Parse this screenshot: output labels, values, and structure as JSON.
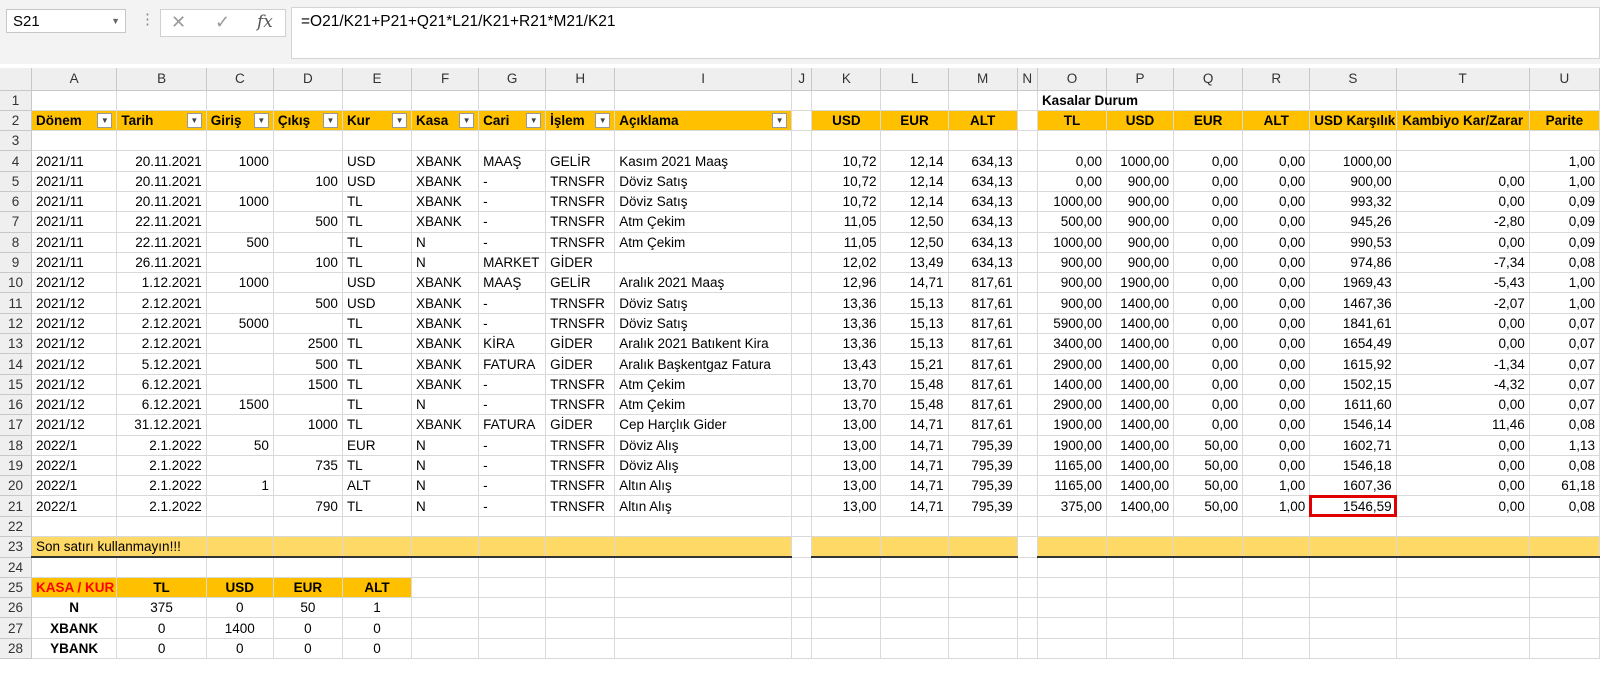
{
  "formula_bar": {
    "name_box": "S21",
    "formula": "=O21/K21+P21+Q21*L21/K21+R21*M21/K21"
  },
  "columns": [
    "",
    "A",
    "B",
    "C",
    "D",
    "E",
    "F",
    "G",
    "H",
    "I",
    "J",
    "K",
    "L",
    "M",
    "N",
    "O",
    "P",
    "Q",
    "R",
    "S",
    "T",
    "U"
  ],
  "rows": [
    {
      "n": "1",
      "cells": {
        "O": "Kasalar Durum"
      }
    },
    {
      "n": "2",
      "cells": {
        "A": "Dönem",
        "B": "Tarih",
        "C": "Giriş",
        "D": "Çıkış",
        "E": "Kur",
        "F": "Kasa",
        "G": "Cari",
        "H": "İşlem",
        "I": "Açıklama",
        "K": "USD",
        "L": "EUR",
        "M": "ALT",
        "O": "TL",
        "P": "USD",
        "Q": "EUR",
        "R": "ALT",
        "S": "USD Karşılık",
        "T": "Kambiyo Kar/Zarar",
        "U": "Parite"
      }
    },
    {
      "n": "3",
      "cells": {}
    },
    {
      "n": "4",
      "cells": {
        "A": "2021/11",
        "B": "20.11.2021",
        "C": "1000",
        "D": "",
        "E": "USD",
        "F": "XBANK",
        "G": "MAAŞ",
        "H": "GELİR",
        "I": "Kasım 2021 Maaş",
        "K": "10,72",
        "L": "12,14",
        "M": "634,13",
        "O": "0,00",
        "P": "1000,00",
        "Q": "0,00",
        "R": "0,00",
        "S": "1000,00",
        "T": "",
        "U": "1,00"
      }
    },
    {
      "n": "5",
      "cells": {
        "A": "2021/11",
        "B": "20.11.2021",
        "C": "",
        "D": "100",
        "E": "USD",
        "F": "XBANK",
        "G": "-",
        "H": "TRNSFR",
        "I": "Döviz Satış",
        "K": "10,72",
        "L": "12,14",
        "M": "634,13",
        "O": "0,00",
        "P": "900,00",
        "Q": "0,00",
        "R": "0,00",
        "S": "900,00",
        "T": "0,00",
        "U": "1,00"
      }
    },
    {
      "n": "6",
      "cells": {
        "A": "2021/11",
        "B": "20.11.2021",
        "C": "1000",
        "D": "",
        "E": "TL",
        "F": "XBANK",
        "G": "-",
        "H": "TRNSFR",
        "I": "Döviz Satış",
        "K": "10,72",
        "L": "12,14",
        "M": "634,13",
        "O": "1000,00",
        "P": "900,00",
        "Q": "0,00",
        "R": "0,00",
        "S": "993,32",
        "T": "0,00",
        "U": "0,09"
      }
    },
    {
      "n": "7",
      "cells": {
        "A": "2021/11",
        "B": "22.11.2021",
        "C": "",
        "D": "500",
        "E": "TL",
        "F": "XBANK",
        "G": "-",
        "H": "TRNSFR",
        "I": "Atm Çekim",
        "K": "11,05",
        "L": "12,50",
        "M": "634,13",
        "O": "500,00",
        "P": "900,00",
        "Q": "0,00",
        "R": "0,00",
        "S": "945,26",
        "T": "-2,80",
        "U": "0,09"
      }
    },
    {
      "n": "8",
      "cells": {
        "A": "2021/11",
        "B": "22.11.2021",
        "C": "500",
        "D": "",
        "E": "TL",
        "F": "N",
        "G": "-",
        "H": "TRNSFR",
        "I": "Atm Çekim",
        "K": "11,05",
        "L": "12,50",
        "M": "634,13",
        "O": "1000,00",
        "P": "900,00",
        "Q": "0,00",
        "R": "0,00",
        "S": "990,53",
        "T": "0,00",
        "U": "0,09"
      }
    },
    {
      "n": "9",
      "cells": {
        "A": "2021/11",
        "B": "26.11.2021",
        "C": "",
        "D": "100",
        "E": "TL",
        "F": "N",
        "G": "MARKET",
        "H": "GİDER",
        "I": "",
        "K": "12,02",
        "L": "13,49",
        "M": "634,13",
        "O": "900,00",
        "P": "900,00",
        "Q": "0,00",
        "R": "0,00",
        "S": "974,86",
        "T": "-7,34",
        "U": "0,08"
      }
    },
    {
      "n": "10",
      "cells": {
        "A": "2021/12",
        "B": "1.12.2021",
        "C": "1000",
        "D": "",
        "E": "USD",
        "F": "XBANK",
        "G": "MAAŞ",
        "H": "GELİR",
        "I": "Aralık 2021 Maaş",
        "K": "12,96",
        "L": "14,71",
        "M": "817,61",
        "O": "900,00",
        "P": "1900,00",
        "Q": "0,00",
        "R": "0,00",
        "S": "1969,43",
        "T": "-5,43",
        "U": "1,00"
      }
    },
    {
      "n": "11",
      "cells": {
        "A": "2021/12",
        "B": "2.12.2021",
        "C": "",
        "D": "500",
        "E": "USD",
        "F": "XBANK",
        "G": "-",
        "H": "TRNSFR",
        "I": "Döviz Satış",
        "K": "13,36",
        "L": "15,13",
        "M": "817,61",
        "O": "900,00",
        "P": "1400,00",
        "Q": "0,00",
        "R": "0,00",
        "S": "1467,36",
        "T": "-2,07",
        "U": "1,00"
      }
    },
    {
      "n": "12",
      "cells": {
        "A": "2021/12",
        "B": "2.12.2021",
        "C": "5000",
        "D": "",
        "E": "TL",
        "F": "XBANK",
        "G": "-",
        "H": "TRNSFR",
        "I": "Döviz Satış",
        "K": "13,36",
        "L": "15,13",
        "M": "817,61",
        "O": "5900,00",
        "P": "1400,00",
        "Q": "0,00",
        "R": "0,00",
        "S": "1841,61",
        "T": "0,00",
        "U": "0,07"
      }
    },
    {
      "n": "13",
      "cells": {
        "A": "2021/12",
        "B": "2.12.2021",
        "C": "",
        "D": "2500",
        "E": "TL",
        "F": "XBANK",
        "G": "KİRA",
        "H": "GİDER",
        "I": "Aralık 2021 Batıkent Kira",
        "K": "13,36",
        "L": "15,13",
        "M": "817,61",
        "O": "3400,00",
        "P": "1400,00",
        "Q": "0,00",
        "R": "0,00",
        "S": "1654,49",
        "T": "0,00",
        "U": "0,07"
      }
    },
    {
      "n": "14",
      "cells": {
        "A": "2021/12",
        "B": "5.12.2021",
        "C": "",
        "D": "500",
        "E": "TL",
        "F": "XBANK",
        "G": "FATURA",
        "H": "GİDER",
        "I": "Aralık Başkentgaz Fatura",
        "K": "13,43",
        "L": "15,21",
        "M": "817,61",
        "O": "2900,00",
        "P": "1400,00",
        "Q": "0,00",
        "R": "0,00",
        "S": "1615,92",
        "T": "-1,34",
        "U": "0,07"
      }
    },
    {
      "n": "15",
      "cells": {
        "A": "2021/12",
        "B": "6.12.2021",
        "C": "",
        "D": "1500",
        "E": "TL",
        "F": "XBANK",
        "G": "-",
        "H": "TRNSFR",
        "I": "Atm Çekim",
        "K": "13,70",
        "L": "15,48",
        "M": "817,61",
        "O": "1400,00",
        "P": "1400,00",
        "Q": "0,00",
        "R": "0,00",
        "S": "1502,15",
        "T": "-4,32",
        "U": "0,07"
      }
    },
    {
      "n": "16",
      "cells": {
        "A": "2021/12",
        "B": "6.12.2021",
        "C": "1500",
        "D": "",
        "E": "TL",
        "F": "N",
        "G": "-",
        "H": "TRNSFR",
        "I": "Atm Çekim",
        "K": "13,70",
        "L": "15,48",
        "M": "817,61",
        "O": "2900,00",
        "P": "1400,00",
        "Q": "0,00",
        "R": "0,00",
        "S": "1611,60",
        "T": "0,00",
        "U": "0,07"
      }
    },
    {
      "n": "17",
      "cells": {
        "A": "2021/12",
        "B": "31.12.2021",
        "C": "",
        "D": "1000",
        "E": "TL",
        "F": "XBANK",
        "G": "FATURA",
        "H": "GİDER",
        "I": "Cep Harçlık Gider",
        "K": "13,00",
        "L": "14,71",
        "M": "817,61",
        "O": "1900,00",
        "P": "1400,00",
        "Q": "0,00",
        "R": "0,00",
        "S": "1546,14",
        "T": "11,46",
        "U": "0,08"
      }
    },
    {
      "n": "18",
      "cells": {
        "A": "2022/1",
        "B": "2.1.2022",
        "C": "50",
        "D": "",
        "E": "EUR",
        "F": "N",
        "G": "-",
        "H": "TRNSFR",
        "I": "Döviz Alış",
        "K": "13,00",
        "L": "14,71",
        "M": "795,39",
        "O": "1900,00",
        "P": "1400,00",
        "Q": "50,00",
        "R": "0,00",
        "S": "1602,71",
        "T": "0,00",
        "U": "1,13"
      }
    },
    {
      "n": "19",
      "cells": {
        "A": "2022/1",
        "B": "2.1.2022",
        "C": "",
        "D": "735",
        "E": "TL",
        "F": "N",
        "G": "-",
        "H": "TRNSFR",
        "I": "Döviz Alış",
        "K": "13,00",
        "L": "14,71",
        "M": "795,39",
        "O": "1165,00",
        "P": "1400,00",
        "Q": "50,00",
        "R": "0,00",
        "S": "1546,18",
        "T": "0,00",
        "U": "0,08"
      }
    },
    {
      "n": "20",
      "cells": {
        "A": "2022/1",
        "B": "2.1.2022",
        "C": "1",
        "D": "",
        "E": "ALT",
        "F": "N",
        "G": "-",
        "H": "TRNSFR",
        "I": "Altın Alış",
        "K": "13,00",
        "L": "14,71",
        "M": "795,39",
        "O": "1165,00",
        "P": "1400,00",
        "Q": "50,00",
        "R": "1,00",
        "S": "1607,36",
        "T": "0,00",
        "U": "61,18"
      }
    },
    {
      "n": "21",
      "cells": {
        "A": "2022/1",
        "B": "2.1.2022",
        "C": "",
        "D": "790",
        "E": "TL",
        "F": "N",
        "G": "-",
        "H": "TRNSFR",
        "I": "Altın Alış",
        "K": "13,00",
        "L": "14,71",
        "M": "795,39",
        "O": "375,00",
        "P": "1400,00",
        "Q": "50,00",
        "R": "1,00",
        "S": "1546,59",
        "T": "0,00",
        "U": "0,08"
      }
    },
    {
      "n": "22",
      "cells": {}
    },
    {
      "n": "23",
      "cells": {
        "A": "Son satırı kullanmayın!!!"
      }
    },
    {
      "n": "24",
      "cells": {}
    },
    {
      "n": "25",
      "cells": {
        "A": "KASA / KUR",
        "B": "TL",
        "C": "USD",
        "D": "EUR",
        "E": "ALT"
      }
    },
    {
      "n": "26",
      "cells": {
        "A": "N",
        "B": "375",
        "C": "0",
        "D": "50",
        "E": "1"
      }
    },
    {
      "n": "27",
      "cells": {
        "A": "XBANK",
        "B": "0",
        "C": "1400",
        "D": "0",
        "E": "0"
      }
    },
    {
      "n": "28",
      "cells": {
        "A": "YBANK",
        "B": "0",
        "C": "0",
        "D": "0",
        "E": "0"
      }
    }
  ],
  "colors": {
    "header_yellow": "#ffc000",
    "note_yellow": "#ffd966",
    "selection": "#e00000",
    "warning_text": "#ff0000"
  }
}
